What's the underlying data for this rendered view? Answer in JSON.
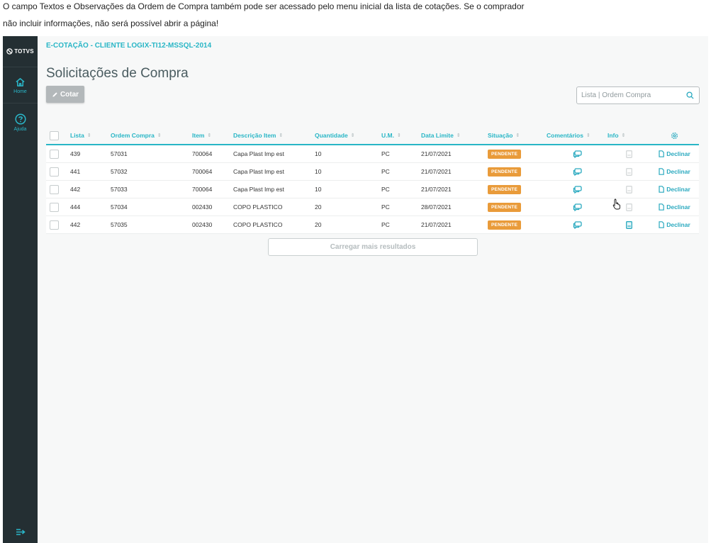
{
  "intro": {
    "line1": "O campo Textos e Observações da Ordem de Compra também pode ser acessado pelo menu inicial da lista de cotações. Se o comprador",
    "line2": "não incluir informações, não será possível abrir a página!"
  },
  "sidebar": {
    "logo_text": "TOTVS",
    "items": [
      {
        "label": "Home",
        "icon": "home-icon"
      },
      {
        "label": "Ajuda",
        "icon": "help-icon"
      }
    ]
  },
  "header": {
    "client": "E-COTAÇÃO - CLIENTE LOGIX-TI12-MSSQL-2014",
    "title": "Solicitações de Compra",
    "cotar_label": "Cotar",
    "search_placeholder": "Lista | Ordem Compra"
  },
  "table": {
    "columns": [
      "Lista",
      "Ordem Compra",
      "Item",
      "Descrição Item",
      "Quantidade",
      "U.M.",
      "Data Limite",
      "Situação",
      "Comentários",
      "Info"
    ],
    "rows": [
      {
        "lista": "439",
        "ordem": "57031",
        "item": "700064",
        "descricao": "Capa Plast Imp est",
        "quantidade": "10",
        "um": "PC",
        "data": "21/07/2021",
        "situacao": "PENDENTE",
        "acao": "Declinar"
      },
      {
        "lista": "441",
        "ordem": "57032",
        "item": "700064",
        "descricao": "Capa Plast Imp est",
        "quantidade": "10",
        "um": "PC",
        "data": "21/07/2021",
        "situacao": "PENDENTE",
        "acao": "Declinar"
      },
      {
        "lista": "442",
        "ordem": "57033",
        "item": "700064",
        "descricao": "Capa Plast Imp est",
        "quantidade": "10",
        "um": "PC",
        "data": "21/07/2021",
        "situacao": "PENDENTE",
        "acao": "Declinar"
      },
      {
        "lista": "444",
        "ordem": "57034",
        "item": "002430",
        "descricao": "COPO PLASTICO",
        "quantidade": "20",
        "um": "PC",
        "data": "28/07/2021",
        "situacao": "PENDENTE",
        "acao": "Declinar"
      },
      {
        "lista": "442",
        "ordem": "57035",
        "item": "002430",
        "descricao": "COPO PLASTICO",
        "quantidade": "20",
        "um": "PC",
        "data": "21/07/2021",
        "situacao": "PENDENTE",
        "acao": "Declinar"
      }
    ],
    "load_more": "Carregar mais resultados"
  },
  "colors": {
    "accent": "#29b6c6",
    "sidebar": "#242f33",
    "badge": "#e99b3a"
  }
}
